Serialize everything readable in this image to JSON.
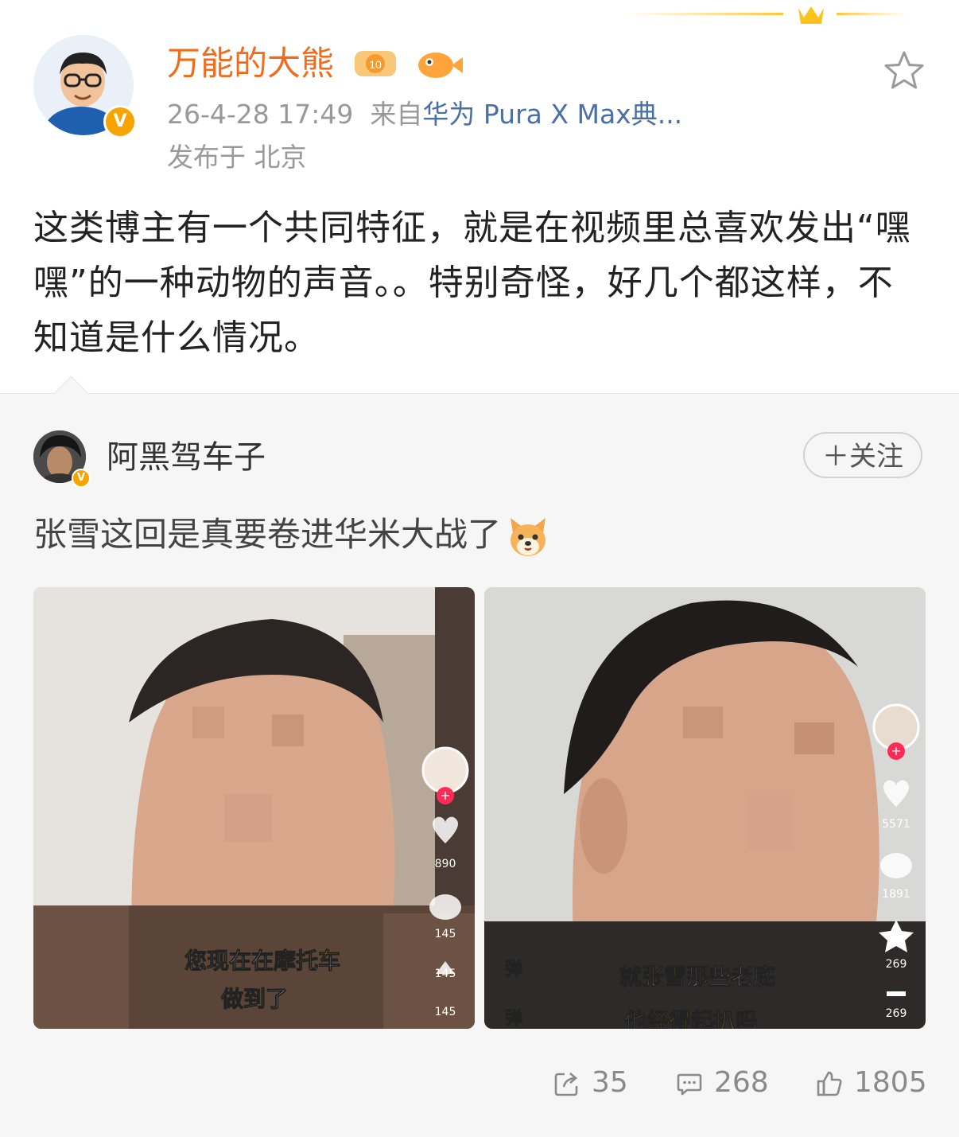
{
  "post": {
    "author": "万能的大熊",
    "time": "26-4-28 17:49",
    "source_prefix": "来自",
    "source": "华为 Pura X Max典...",
    "location": "发布于 北京",
    "text": "这类博主有一个共同特征，就是在视频里总喜欢发出“嘿嘿”的一种动物的声音。。特别奇怪，好几个都这样，不知道是什么情况。",
    "verified_mark": "V"
  },
  "repost": {
    "author": "阿黑驾车子",
    "verified_mark": "V",
    "follow_label": "＋关注",
    "text": "张雪这回是真要卷进华米大战了",
    "emoji_icon": "dog-emoji-icon",
    "videos": [
      {
        "caption1_pre": "您现在在",
        "caption1_hl": "摩托车",
        "caption2_pre": "做到",
        "caption2_post": "了",
        "likes": "890",
        "comments": "145",
        "shares": "145",
        "extra": "145"
      },
      {
        "caption1_pre": "就",
        "caption1_hl": "张雪",
        "caption1_post": "那些老底",
        "caption2_pre": "他",
        "caption2_hl": "经得起扒",
        "caption2_post": "吗",
        "danmaku": "弹",
        "likes": "5571",
        "comments": "1891",
        "favorites": "269",
        "shares": "269"
      }
    ]
  },
  "actions": {
    "repost_count": "35",
    "comment_count": "268",
    "like_count": "1805"
  },
  "colors": {
    "username": "#f26b1d",
    "source_link": "#4a6ea8",
    "verified": "#f7a400",
    "repost_bg": "#f6f6f6"
  }
}
